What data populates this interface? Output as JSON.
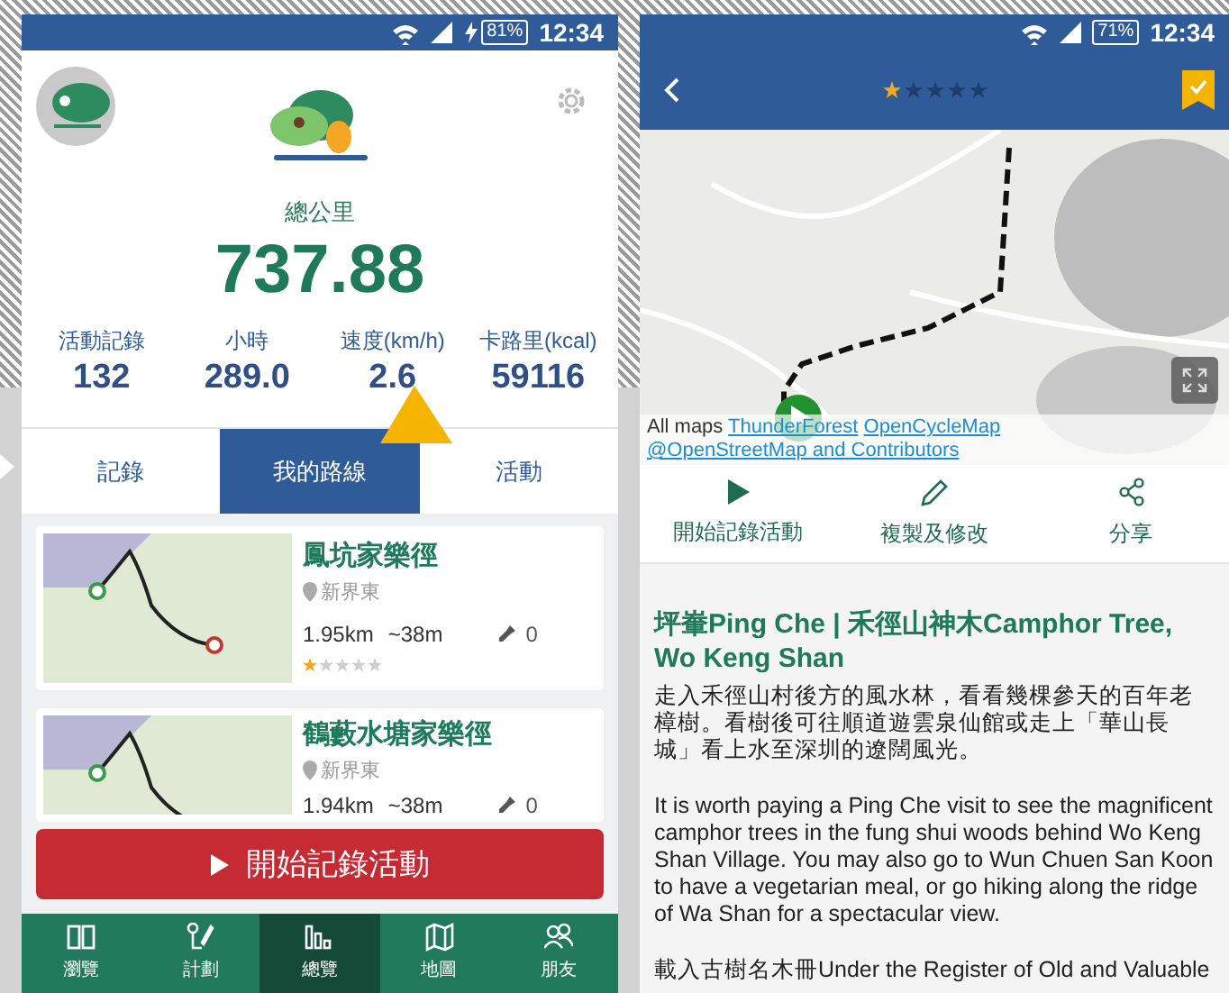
{
  "left_phone": {
    "status_bar": {
      "battery": "81%",
      "time": "12:34",
      "charging": true
    },
    "total_label": "總公里",
    "total": "737.88",
    "stats": [
      {
        "label": "活動記錄",
        "value": "132"
      },
      {
        "label": "小時",
        "value": "289.0"
      },
      {
        "label": "速度(km/h)",
        "value": "2.6"
      },
      {
        "label": "卡路里(kcal)",
        "value": "59116"
      }
    ],
    "tabs": [
      {
        "label": "記錄",
        "selected": false
      },
      {
        "label": "我的路線",
        "selected": true
      },
      {
        "label": "活動",
        "selected": false
      }
    ],
    "routes": [
      {
        "name": "鳳坑家樂徑",
        "region": "新界東",
        "distance": "1.95km",
        "elevation": "~38m",
        "pins": "0",
        "stars": 1
      },
      {
        "name": "鶴藪水塘家樂徑",
        "region": "新界東",
        "distance": "1.94km",
        "elevation": "~38m",
        "pins": "0"
      }
    ],
    "start_button": "開始記錄活動",
    "nav": [
      {
        "kind": "browse",
        "label": "瀏覽",
        "selected": false
      },
      {
        "kind": "plan",
        "label": "計劃",
        "selected": false
      },
      {
        "kind": "overview",
        "label": "總覽",
        "selected": true
      },
      {
        "kind": "map",
        "label": "地圖",
        "selected": false
      },
      {
        "kind": "friends",
        "label": "朋友",
        "selected": false
      }
    ]
  },
  "right_phone": {
    "status_bar": {
      "battery": "71%",
      "time": "12:34",
      "charging": false
    },
    "stars": 1,
    "bookmarked": true,
    "attribution": {
      "prefix": "All maps",
      "links": [
        "ThunderForest",
        "OpenCycleMap",
        "@OpenStreetMap and Contributors"
      ]
    },
    "actions": [
      {
        "kind": "play",
        "label": "開始記錄活動"
      },
      {
        "kind": "edit",
        "label": "複製及修改"
      },
      {
        "kind": "share",
        "label": "分享"
      }
    ],
    "article": {
      "title": "坪輋Ping Che | 禾徑山神木Camphor Tree, Wo Keng Shan",
      "paragraphs": [
        "走入禾徑山村後方的風水林，看看幾棵參天的百年老樟樹。看樹後可往順道遊雲泉仙館或走上「華山長城」看上水至深圳的遼闊風光。",
        "It is worth paying a Ping Che visit to see the magnificent camphor trees in the fung shui woods behind Wo Keng Shan Village. You may also go to Wun Chuen San Koon to have a vegetarian meal, or go hiking along the ridge of Wa Shan for a spectacular view.",
        "載入古樹名木冊Under the Register of Old and Valuable"
      ]
    }
  }
}
